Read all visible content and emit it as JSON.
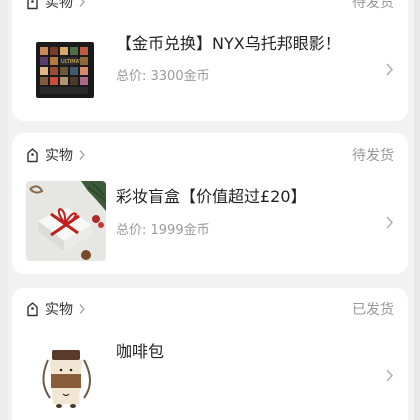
{
  "orders": [
    {
      "category": "实物",
      "status": "待发货",
      "title": "【金币兑换】NYX乌托邦眼影！",
      "price": "总价: 3300金币",
      "thumb_icon": "eyeshadow-palette-image"
    },
    {
      "category": "实物",
      "status": "待发货",
      "title": "彩妆盲盒【价值超过£20】",
      "price": "总价: 1999金币",
      "thumb_icon": "gift-box-image"
    },
    {
      "category": "实物",
      "status": "已发货",
      "title": "咖啡包",
      "price": "",
      "thumb_icon": "coffee-bag-image"
    }
  ],
  "colors": {
    "page_bg": "#f2f2f2",
    "card_bg": "#ffffff",
    "text_primary": "#222222",
    "text_secondary": "#999999"
  }
}
